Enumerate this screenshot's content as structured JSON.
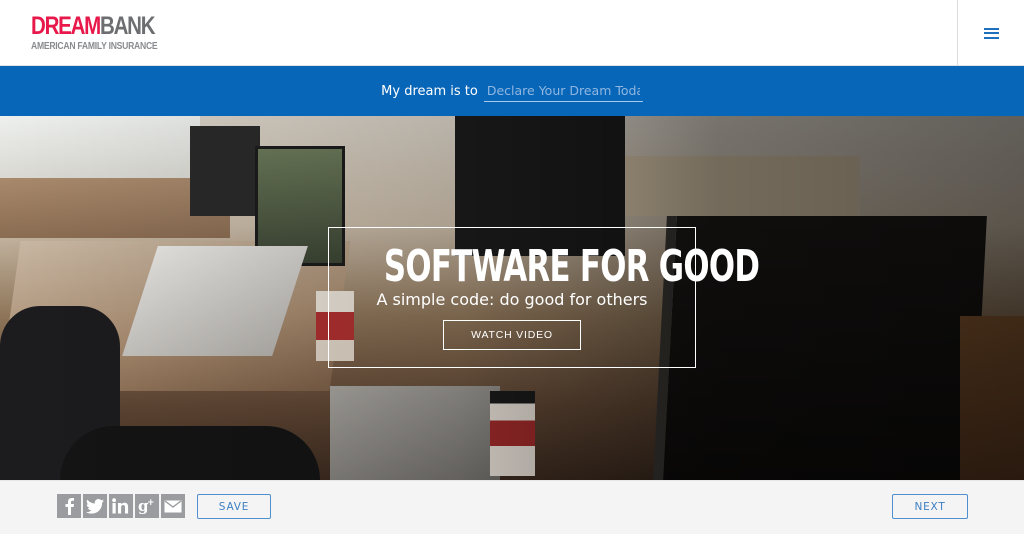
{
  "header": {
    "logo": {
      "brand_part1": "DREAM",
      "brand_part2": "BANK",
      "subtitle": "AMERICAN FAMILY INSURANCE"
    },
    "menu_icon": "hamburger-menu-icon"
  },
  "dream_bar": {
    "label": "My dream is to",
    "input_value": "",
    "input_placeholder": "Declare Your Dream Today"
  },
  "hero": {
    "title": "SOFTWARE FOR GOOD",
    "subtitle": "A simple code: do good for others",
    "watch_button_label": "WATCH VIDEO"
  },
  "footer": {
    "social": [
      {
        "name": "facebook",
        "icon": "facebook-icon"
      },
      {
        "name": "twitter",
        "icon": "twitter-icon"
      },
      {
        "name": "linkedin",
        "icon": "linkedin-icon"
      },
      {
        "name": "google-plus",
        "icon": "google-plus-icon"
      },
      {
        "name": "email",
        "icon": "email-icon"
      }
    ],
    "save_label": "SAVE",
    "next_label": "NEXT"
  },
  "colors": {
    "brand_red": "#e8194a",
    "brand_gray": "#6d6e71",
    "bar_blue": "#0866b8",
    "button_blue": "#3d7fc3",
    "social_gray": "#9b9c9f"
  }
}
